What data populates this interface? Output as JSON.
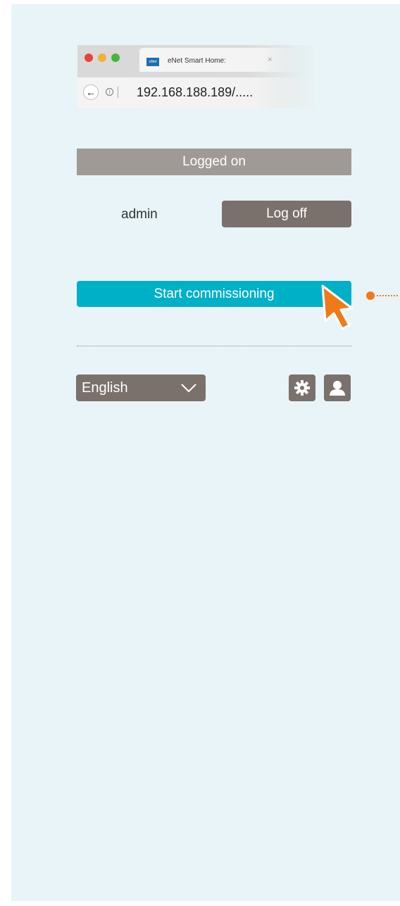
{
  "browser": {
    "tab_title": "eNet Smart Home:",
    "favicon_text": "eNet",
    "close_glyph": "×",
    "back_glyph": "←",
    "info_glyph": "i",
    "url": "192.168.188.189/....."
  },
  "status": {
    "label": "Logged on"
  },
  "user": {
    "name": "admin",
    "logoff_label": "Log off"
  },
  "actions": {
    "start_commissioning_label": "Start commissioning"
  },
  "footer": {
    "language": "English",
    "settings_icon": "gear-icon",
    "account_icon": "user-icon"
  },
  "colors": {
    "background": "#e8f4f7",
    "accent": "#00b0c6",
    "button_gray": "#7a716d",
    "status_gray": "#a09a96",
    "highlight_orange": "#ee7a18"
  }
}
